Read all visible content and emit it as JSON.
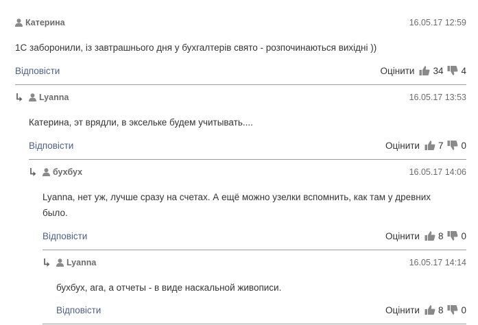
{
  "common": {
    "reply_label": "Відповісти",
    "rate_label": "Оцінити"
  },
  "comments": [
    {
      "author": "Катерина",
      "date": "16.05.17 12:59",
      "text": "1С заборонили, із завтрашнього дня у бухгалтерів свято - розпочинаються вихідні ))",
      "likes": "34",
      "dislikes": "4"
    },
    {
      "author": "Lyanna",
      "date": "16.05.17 13:53",
      "text": "Катерина, эт врядли, в экселькe будем учитывать....",
      "likes": "7",
      "dislikes": "0"
    },
    {
      "author": "бухбух",
      "date": "16.05.17 14:06",
      "text": "Lyanna, нет уж, лучше сразу на счетах. А ещё можно узелки вспомнить, как там у древних было.",
      "likes": "8",
      "dislikes": "0"
    },
    {
      "author": "Lyanna",
      "date": "16.05.17 14:14",
      "text": "бухбух, ага, а отчеты - в виде наскальной живописи.",
      "likes": "8",
      "dislikes": "0"
    }
  ],
  "colors": {
    "link": "#4b5f87",
    "meta": "#6b6b6b",
    "icon": "#8a8a8a",
    "separator": "#9a9a9a"
  }
}
